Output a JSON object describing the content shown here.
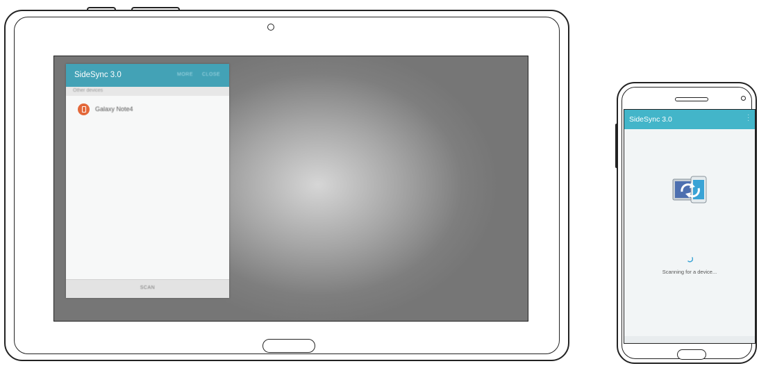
{
  "tablet": {
    "app": {
      "title": "SideSync 3.0",
      "header_actions": [
        "MORE",
        "CLOSE"
      ],
      "section_label": "Other devices",
      "devices": [
        {
          "name": "Galaxy Note4",
          "icon": "phone-icon",
          "icon_color": "#e3683a"
        }
      ],
      "footer_button": "SCAN"
    },
    "colors": {
      "header": "#43a2b6"
    }
  },
  "phone": {
    "app": {
      "title": "SideSync 3.0",
      "logo": "sidesync-logo-icon",
      "status_text": "Scanning for a device..."
    },
    "colors": {
      "header": "#43b5c9"
    }
  }
}
